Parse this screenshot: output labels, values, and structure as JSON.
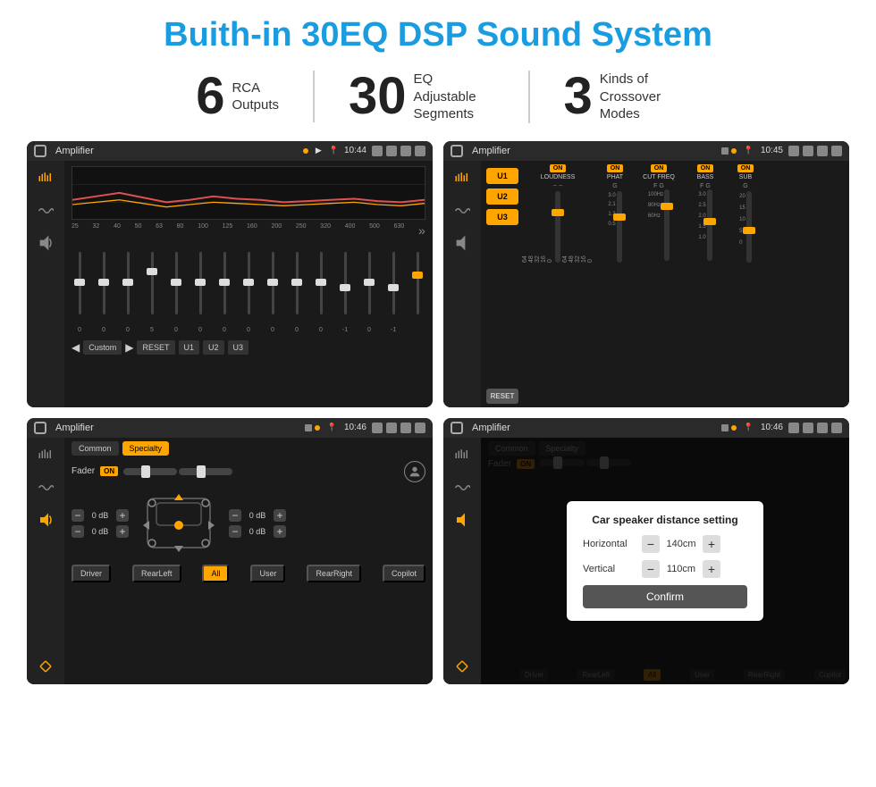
{
  "title": "Buith-in 30EQ DSP Sound System",
  "stats": [
    {
      "number": "6",
      "label": "RCA\nOutputs"
    },
    {
      "number": "30",
      "label": "EQ Adjustable\nSegments"
    },
    {
      "number": "3",
      "label": "Kinds of\nCrossover Modes"
    }
  ],
  "screens": [
    {
      "id": "screen1",
      "title": "Amplifier",
      "time": "10:44",
      "description": "EQ Screen",
      "freqs": [
        "25",
        "32",
        "40",
        "50",
        "63",
        "80",
        "100",
        "125",
        "160",
        "200",
        "250",
        "320",
        "400",
        "500",
        "630"
      ],
      "values": [
        "0",
        "0",
        "0",
        "5",
        "0",
        "0",
        "0",
        "0",
        "0",
        "0",
        "0",
        "-1",
        "0",
        "-1",
        ""
      ],
      "bottomBtns": [
        "Custom",
        "RESET",
        "U1",
        "U2",
        "U3"
      ]
    },
    {
      "id": "screen2",
      "title": "Amplifier",
      "time": "10:45",
      "description": "Crossover Screen",
      "presets": [
        "U1",
        "U2",
        "U3"
      ],
      "channels": [
        {
          "toggle": "ON",
          "label": "LOUDNESS"
        },
        {
          "toggle": "ON",
          "label": "PHAT"
        },
        {
          "toggle": "ON",
          "label": "CUT FREQ"
        },
        {
          "toggle": "ON",
          "label": "BASS"
        },
        {
          "toggle": "ON",
          "label": "SUB"
        }
      ],
      "resetBtn": "RESET"
    },
    {
      "id": "screen3",
      "title": "Amplifier",
      "time": "10:46",
      "description": "Fader Screen",
      "tabs": [
        "Common",
        "Specialty"
      ],
      "activeTab": "Specialty",
      "faderLabel": "Fader",
      "faderOn": "ON",
      "volumes": [
        {
          "value": "0 dB"
        },
        {
          "value": "0 dB"
        },
        {
          "value": "0 dB"
        },
        {
          "value": "0 dB"
        }
      ],
      "buttons": [
        "Driver",
        "RearLeft",
        "All",
        "User",
        "RearRight",
        "Copilot"
      ]
    },
    {
      "id": "screen4",
      "title": "Amplifier",
      "time": "10:46",
      "description": "Speaker Distance Dialog",
      "tabs": [
        "Common",
        "Specialty"
      ],
      "dialog": {
        "title": "Car speaker distance setting",
        "horizontal": {
          "label": "Horizontal",
          "value": "140cm"
        },
        "vertical": {
          "label": "Vertical",
          "value": "110cm"
        },
        "confirmBtn": "Confirm"
      },
      "buttons": [
        "Driver",
        "RearLeft",
        "All",
        "User",
        "RearRight",
        "Copilot"
      ]
    }
  ]
}
